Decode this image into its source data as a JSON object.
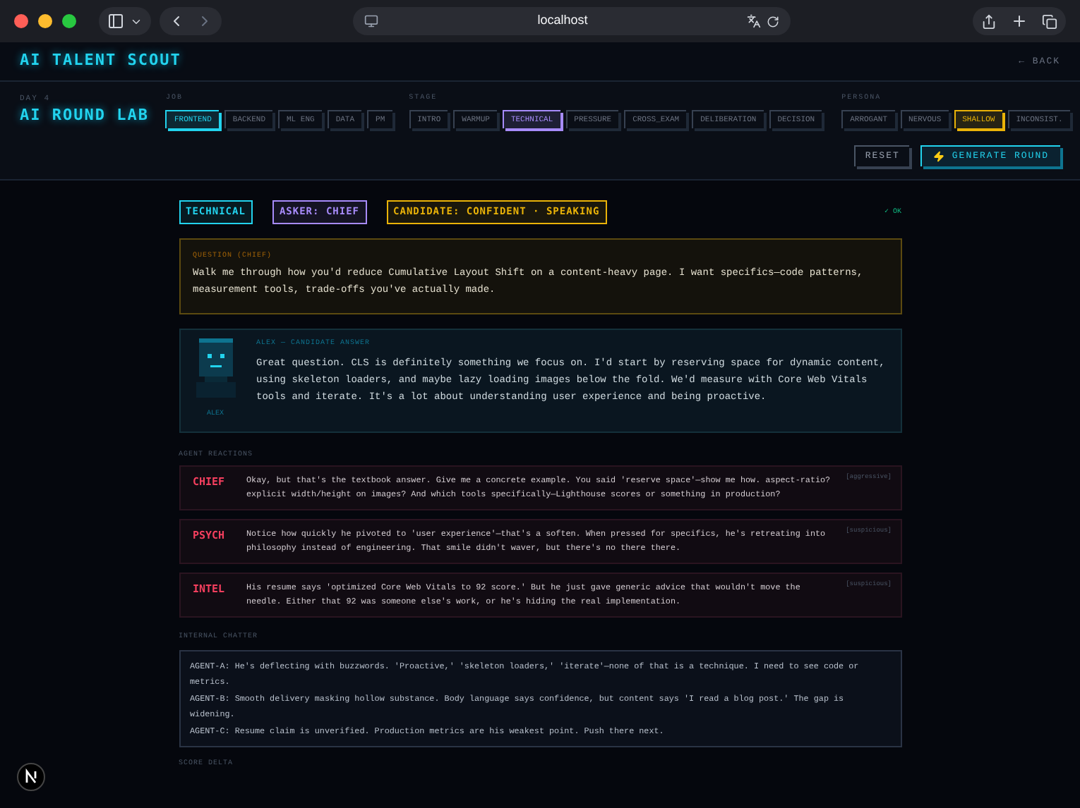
{
  "browser": {
    "url": "localhost"
  },
  "header": {
    "title": "AI TALENT SCOUT",
    "back": "← BACK"
  },
  "lab": {
    "eyebrow": "DAY 4",
    "title": "AI ROUND LAB"
  },
  "filters": [
    {
      "label": "JOB",
      "color": "#22d3ee",
      "options": [
        {
          "label": "FRONTEND",
          "selected": true
        },
        {
          "label": "BACKEND",
          "selected": false
        },
        {
          "label": "ML ENG",
          "selected": false
        },
        {
          "label": "DATA",
          "selected": false
        },
        {
          "label": "PM",
          "selected": false
        }
      ]
    },
    {
      "label": "STAGE",
      "color": "#a78bfa",
      "options": [
        {
          "label": "INTRO",
          "selected": false
        },
        {
          "label": "WARMUP",
          "selected": false
        },
        {
          "label": "TECHNICAL",
          "selected": true
        },
        {
          "label": "PRESSURE",
          "selected": false
        },
        {
          "label": "CROSS_EXAM",
          "selected": false
        },
        {
          "label": "DELIBERATION",
          "selected": false
        },
        {
          "label": "DECISION",
          "selected": false
        }
      ]
    },
    {
      "label": "PERSONA",
      "color": "#eab308",
      "options": [
        {
          "label": "ARROGANT",
          "selected": false
        },
        {
          "label": "NERVOUS",
          "selected": false
        },
        {
          "label": "SHALLOW",
          "selected": true
        },
        {
          "label": "INCONSIST.",
          "selected": false
        }
      ]
    }
  ],
  "actions": [
    {
      "label": "RESET",
      "kind": "secondary"
    },
    {
      "label": "GENERATE ROUND",
      "kind": "primary"
    }
  ],
  "badges": [
    {
      "label": "TECHNICAL",
      "color": "#22d3ee"
    },
    {
      "label": "ASKER: CHIEF",
      "color": "#a78bfa"
    },
    {
      "label": "CANDIDATE: CONFIDENT · SPEAKING",
      "color": "#eab308"
    }
  ],
  "status": "✓ OK",
  "question": {
    "label": "QUESTION (CHIEF)",
    "text": "Walk me through how you'd reduce Cumulative Layout Shift on a content-heavy page. I want specifics—code patterns, measurement tools, trade-offs you've actually made."
  },
  "answer": {
    "label": "ALEX — CANDIDATE ANSWER",
    "name": "ALEX",
    "text": "Great question. CLS is definitely something we focus on. I'd start by reserving space for dynamic content, using skeleton loaders, and maybe lazy loading images below the fold. We'd measure with Core Web Vitals tools and iterate. It's a lot about understanding user experience and being proactive."
  },
  "reactions": {
    "label": "AGENT REACTIONS",
    "items": [
      {
        "agent": "CHIEF",
        "text": "Okay, but that's the textbook answer. Give me a concrete example. You said 'reserve space'—show me how. aspect-ratio? explicit width/height on images? And which tools specifically—Lighthouse scores or something in production?",
        "tone": "[aggressive]"
      },
      {
        "agent": "PSYCH",
        "text": "Notice how quickly he pivoted to 'user experience'—that's a soften. When pressed for specifics, he's retreating into philosophy instead of engineering. That smile didn't waver, but there's no there there.",
        "tone": "[suspicious]"
      },
      {
        "agent": "INTEL",
        "text": "His resume says 'optimized Core Web Vitals to 92 score.' But he just gave generic advice that wouldn't move the needle. Either that 92 was someone else's work, or he's hiding the real implementation.",
        "tone": "[suspicious]"
      }
    ]
  },
  "chatter": {
    "label": "INTERNAL CHATTER",
    "lines": [
      "AGENT-A: He's deflecting with buzzwords. 'Proactive,' 'skeleton loaders,' 'iterate'—none of that is a technique. I need to see code or metrics.",
      "AGENT-B: Smooth delivery masking hollow substance. Body language says confidence, but content says 'I read a blog post.' The gap is widening.",
      "AGENT-C: Resume claim is unverified. Production metrics are his weakest point. Push there next."
    ]
  },
  "score_delta": {
    "label": "SCORE DELTA"
  }
}
